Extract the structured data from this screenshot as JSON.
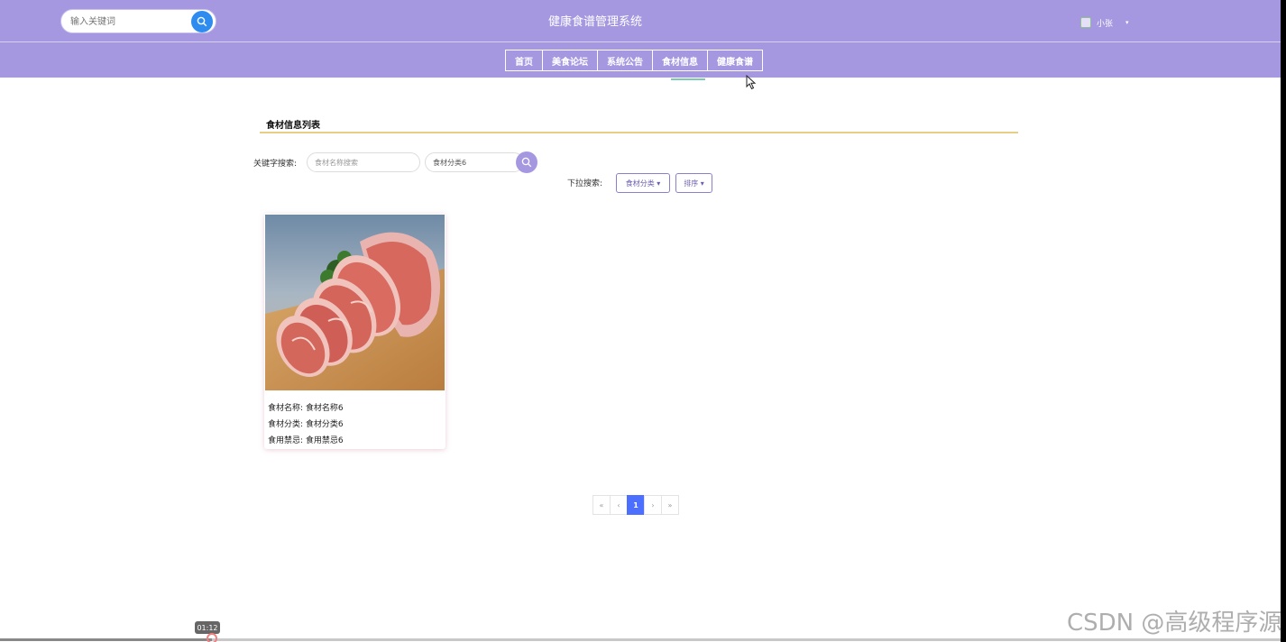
{
  "header": {
    "search_placeholder": "输入关键词",
    "site_title": "健康食谱管理系统",
    "user_name": "小张",
    "user_caret": "▾"
  },
  "nav": {
    "tabs": [
      {
        "label": "首页"
      },
      {
        "label": "美食论坛"
      },
      {
        "label": "系统公告"
      },
      {
        "label": "食材信息"
      },
      {
        "label": "健康食谱"
      }
    ],
    "active_tab": "食材信息"
  },
  "main": {
    "section_title": "食材信息列表",
    "keyword_label": "关键字搜索:",
    "name_placeholder": "食材名称搜索",
    "category_value": "食材分类6",
    "dropdown_label": "下拉搜索:",
    "category_dropdown": "食材分类 ▾",
    "sort_dropdown": "排序 ▾",
    "items": [
      {
        "image_icon": "meat-photo",
        "name_label": "食材名称:",
        "name_value": "食材名称6",
        "category_label": "食材分类:",
        "category_value": "食材分类6",
        "taboo_label": "食用禁忌:",
        "taboo_value": "食用禁忌6"
      }
    ]
  },
  "pagination": {
    "first": "«",
    "prev": "‹",
    "current": "1",
    "next": "›",
    "last": "»"
  },
  "video": {
    "time": "01:12",
    "watermark": "CSDN @高级程序源"
  },
  "colors": {
    "header_bg": "#a598e0",
    "search_button": "#2e8cf0",
    "accent_line": "#e8cd84",
    "pager_active": "#4d6fff"
  }
}
